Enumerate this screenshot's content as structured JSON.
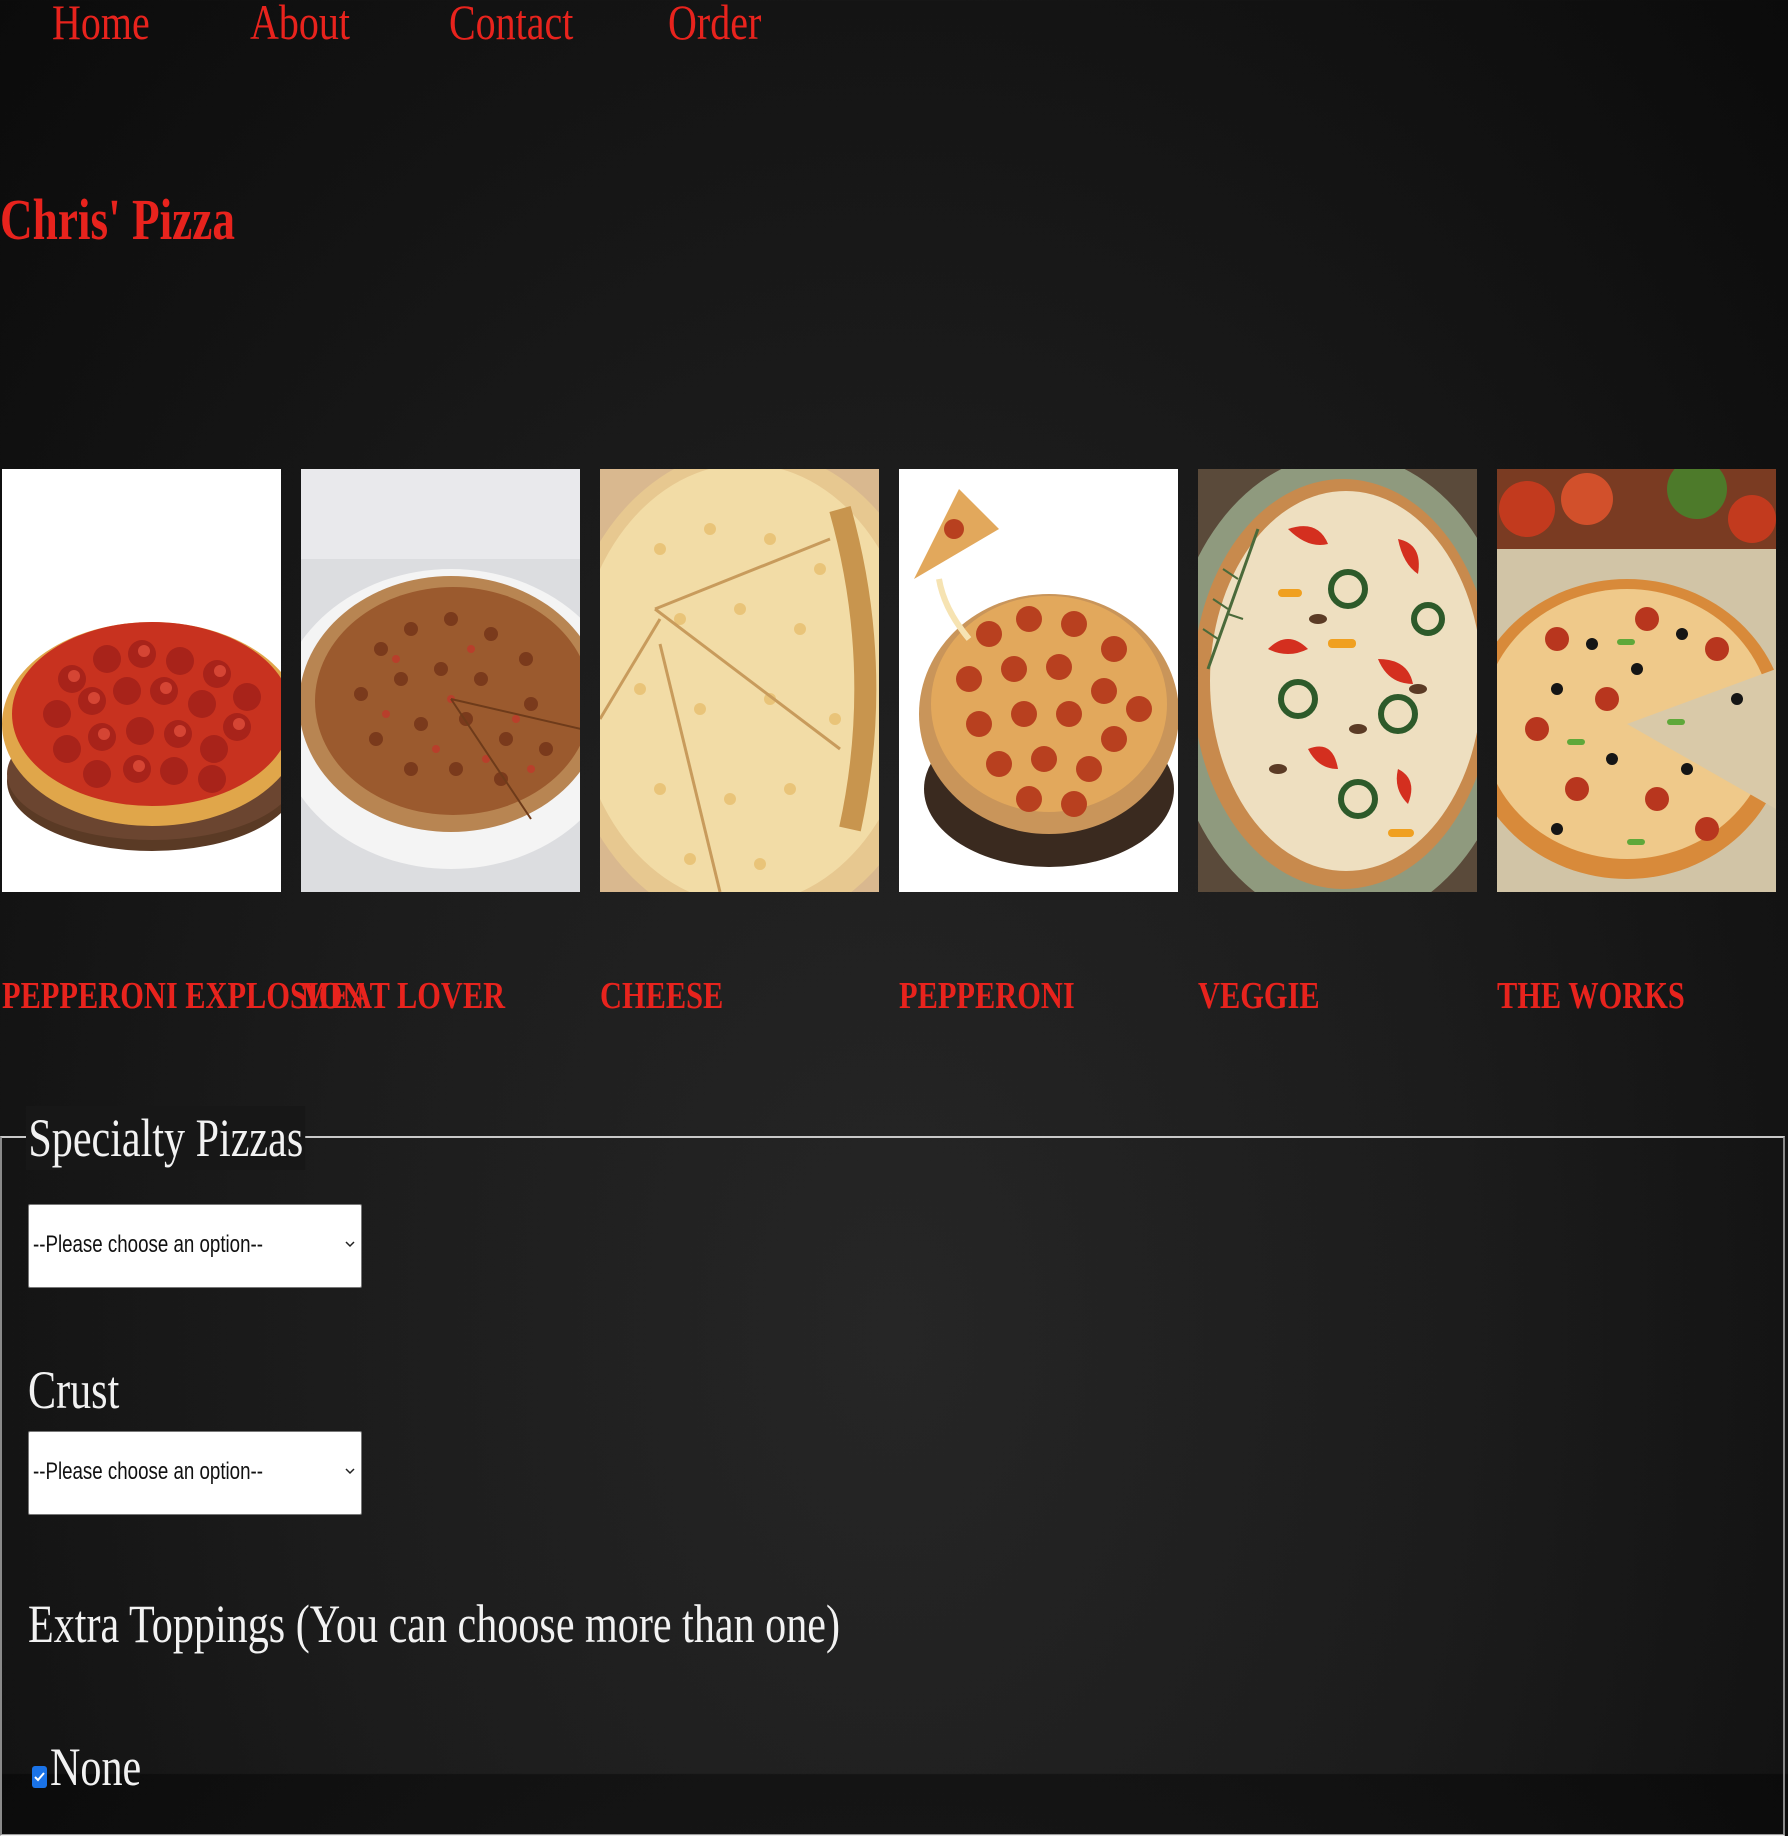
{
  "nav": {
    "items": [
      {
        "label": "Home"
      },
      {
        "label": "About"
      },
      {
        "label": "Contact"
      },
      {
        "label": "Order"
      }
    ]
  },
  "site": {
    "title": "Chris' Pizza"
  },
  "gallery": {
    "pizzas": [
      {
        "name": "PEPPERONI EXPLOSION",
        "image": "pepperoni-explosion-pizza-photo"
      },
      {
        "name": "MEAT LOVER",
        "image": "meat-lover-pizza-photo"
      },
      {
        "name": "CHEESE",
        "image": "cheese-pizza-photo"
      },
      {
        "name": "PEPPERONI",
        "image": "pepperoni-pizza-photo"
      },
      {
        "name": "VEGGIE",
        "image": "veggie-pizza-photo"
      },
      {
        "name": "THE WORKS",
        "image": "the-works-pizza-photo"
      }
    ]
  },
  "form": {
    "legend": "Specialty Pizzas",
    "specialty_select": {
      "value": "--Please choose an option--"
    },
    "crust_label": "Crust",
    "crust_select": {
      "value": "--Please choose an option--"
    },
    "toppings_label": "Extra Toppings (You can choose more than one)",
    "toppings": [
      {
        "label": "None",
        "checked": true
      }
    ]
  },
  "colors": {
    "accent": "#e8231d",
    "text": "#f2f2f2",
    "background": "#161616",
    "checkbox": "#1a73e8"
  }
}
